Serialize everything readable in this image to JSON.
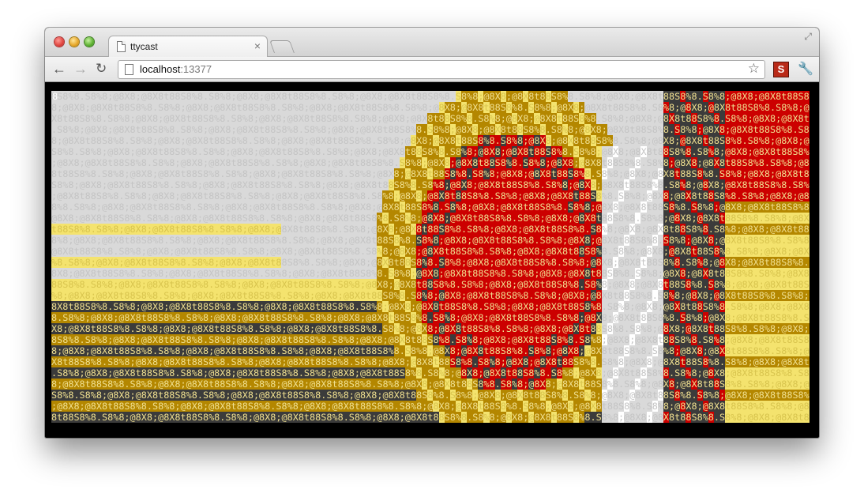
{
  "window": {
    "tab_title": "ttycast",
    "tab_close_glyph": "×",
    "url_host": "localhost",
    "url_port": ":13377",
    "star_glyph": "☆",
    "extension_label": "S",
    "wrench_glyph": "🔧",
    "back_glyph": "←",
    "forward_glyph": "→",
    "reload_glyph": "↻",
    "fullscreen_glyph": "⤢"
  },
  "terminal": {
    "first_char": "8",
    "palette": {
      "light_gray": "#d9d9d9",
      "white": "#ffffff",
      "yellow": "#f4e36e",
      "olive": "#b48700",
      "red": "#cc0000",
      "dark_gray": "#3b3b3b",
      "black": "#000000"
    }
  }
}
